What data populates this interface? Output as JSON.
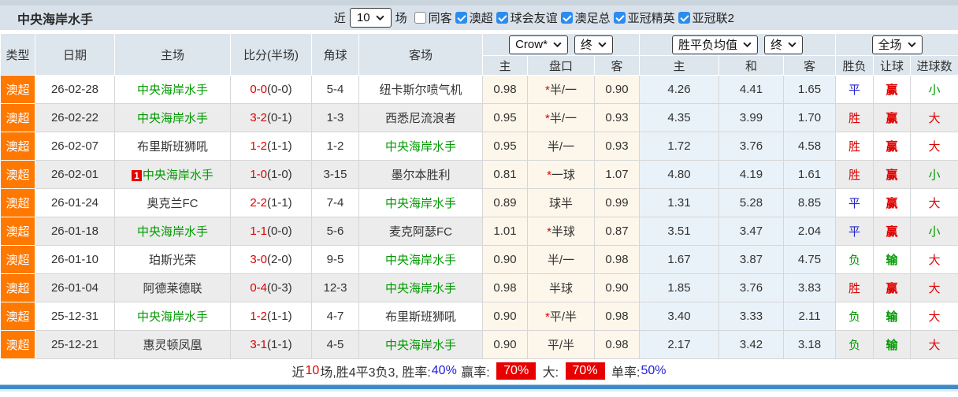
{
  "palette": {
    "orange": "#ff7800",
    "red": "#e00000",
    "green": "#009900",
    "blue": "#2222cc",
    "checkbox_blue": "#2b8ced",
    "header_bg": "#dde6ed",
    "cream_bg": "#fdf6ea",
    "light_blue_bg": "#eaf2f9",
    "bottom_bar_blue": "#3f8ac6"
  },
  "header": {
    "team_title": "中央海岸水手",
    "recent_prefix": "近",
    "recent_value": "10",
    "recent_suffix": "场",
    "filters": [
      {
        "label": "同客",
        "checked": false
      },
      {
        "label": "澳超",
        "checked": true
      },
      {
        "label": "球会友谊",
        "checked": true
      },
      {
        "label": "澳足总",
        "checked": true
      },
      {
        "label": "亚冠精英",
        "checked": true
      },
      {
        "label": "亚冠联2",
        "checked": true
      }
    ]
  },
  "table": {
    "columns": [
      "类型",
      "日期",
      "主场",
      "比分(半场)",
      "角球",
      "客场"
    ],
    "odds_group": {
      "company_select": "Crow*",
      "time_select": "终",
      "subs": [
        "主",
        "盘口",
        "客"
      ]
    },
    "avg_group": {
      "value_select": "胜平负均值",
      "time_select": "终",
      "subs": [
        "主",
        "和",
        "客"
      ]
    },
    "result_group": {
      "scope_select": "全场",
      "subs": [
        "胜负",
        "让球",
        "进球数"
      ]
    },
    "rows": [
      {
        "league": "澳超",
        "date": "26-02-28",
        "home": "中央海岸水手",
        "home_green": true,
        "home_badge": "",
        "score": "0-0",
        "half": "(0-0)",
        "corners": "5-4",
        "away": "纽卡斯尔喷气机",
        "away_green": false,
        "odds_home": "0.98",
        "line": "半/一",
        "line_star": true,
        "odds_away": "0.90",
        "avg_home": "4.26",
        "avg_draw": "4.41",
        "avg_away": "1.65",
        "spf": "平",
        "spf_color": "blue",
        "rq": "赢",
        "rq_color": "red",
        "jq": "小",
        "jq_color": "green"
      },
      {
        "league": "澳超",
        "date": "26-02-22",
        "home": "中央海岸水手",
        "home_green": true,
        "home_badge": "",
        "score": "3-2",
        "half": "(0-1)",
        "corners": "1-3",
        "away": "西悉尼流浪者",
        "away_green": false,
        "odds_home": "0.95",
        "line": "半/一",
        "line_star": true,
        "odds_away": "0.93",
        "avg_home": "4.35",
        "avg_draw": "3.99",
        "avg_away": "1.70",
        "spf": "胜",
        "spf_color": "red",
        "rq": "赢",
        "rq_color": "red",
        "jq": "大",
        "jq_color": "red"
      },
      {
        "league": "澳超",
        "date": "26-02-07",
        "home": "布里斯班狮吼",
        "home_green": false,
        "home_badge": "",
        "score": "1-2",
        "half": "(1-1)",
        "corners": "1-2",
        "away": "中央海岸水手",
        "away_green": true,
        "odds_home": "0.95",
        "line": "半/一",
        "line_star": false,
        "odds_away": "0.93",
        "avg_home": "1.72",
        "avg_draw": "3.76",
        "avg_away": "4.58",
        "spf": "胜",
        "spf_color": "red",
        "rq": "赢",
        "rq_color": "red",
        "jq": "大",
        "jq_color": "red"
      },
      {
        "league": "澳超",
        "date": "26-02-01",
        "home": "中央海岸水手",
        "home_green": true,
        "home_badge": "1",
        "score": "1-0",
        "half": "(1-0)",
        "corners": "3-15",
        "away": "墨尔本胜利",
        "away_green": false,
        "odds_home": "0.81",
        "line": "一球",
        "line_star": true,
        "odds_away": "1.07",
        "avg_home": "4.80",
        "avg_draw": "4.19",
        "avg_away": "1.61",
        "spf": "胜",
        "spf_color": "red",
        "rq": "赢",
        "rq_color": "red",
        "jq": "小",
        "jq_color": "green"
      },
      {
        "league": "澳超",
        "date": "26-01-24",
        "home": "奥克兰FC",
        "home_green": false,
        "home_badge": "",
        "score": "2-2",
        "half": "(1-1)",
        "corners": "7-4",
        "away": "中央海岸水手",
        "away_green": true,
        "odds_home": "0.89",
        "line": "球半",
        "line_star": false,
        "odds_away": "0.99",
        "avg_home": "1.31",
        "avg_draw": "5.28",
        "avg_away": "8.85",
        "spf": "平",
        "spf_color": "blue",
        "rq": "赢",
        "rq_color": "red",
        "jq": "大",
        "jq_color": "red"
      },
      {
        "league": "澳超",
        "date": "26-01-18",
        "home": "中央海岸水手",
        "home_green": true,
        "home_badge": "",
        "score": "1-1",
        "half": "(0-0)",
        "corners": "5-6",
        "away": "麦克阿瑟FC",
        "away_green": false,
        "odds_home": "1.01",
        "line": "半球",
        "line_star": true,
        "odds_away": "0.87",
        "avg_home": "3.51",
        "avg_draw": "3.47",
        "avg_away": "2.04",
        "spf": "平",
        "spf_color": "blue",
        "rq": "赢",
        "rq_color": "red",
        "jq": "小",
        "jq_color": "green"
      },
      {
        "league": "澳超",
        "date": "26-01-10",
        "home": "珀斯光荣",
        "home_green": false,
        "home_badge": "",
        "score": "3-0",
        "half": "(2-0)",
        "corners": "9-5",
        "away": "中央海岸水手",
        "away_green": true,
        "odds_home": "0.90",
        "line": "半/一",
        "line_star": false,
        "odds_away": "0.98",
        "avg_home": "1.67",
        "avg_draw": "3.87",
        "avg_away": "4.75",
        "spf": "负",
        "spf_color": "green",
        "rq": "输",
        "rq_color": "green",
        "jq": "大",
        "jq_color": "red"
      },
      {
        "league": "澳超",
        "date": "26-01-04",
        "home": "阿德莱德联",
        "home_green": false,
        "home_badge": "",
        "score": "0-4",
        "half": "(0-3)",
        "corners": "12-3",
        "away": "中央海岸水手",
        "away_green": true,
        "odds_home": "0.98",
        "line": "半球",
        "line_star": false,
        "odds_away": "0.90",
        "avg_home": "1.85",
        "avg_draw": "3.76",
        "avg_away": "3.83",
        "spf": "胜",
        "spf_color": "red",
        "rq": "赢",
        "rq_color": "red",
        "jq": "大",
        "jq_color": "red"
      },
      {
        "league": "澳超",
        "date": "25-12-31",
        "home": "中央海岸水手",
        "home_green": true,
        "home_badge": "",
        "score": "1-2",
        "half": "(1-1)",
        "corners": "4-7",
        "away": "布里斯班狮吼",
        "away_green": false,
        "odds_home": "0.90",
        "line": "平/半",
        "line_star": true,
        "odds_away": "0.98",
        "avg_home": "3.40",
        "avg_draw": "3.33",
        "avg_away": "2.11",
        "spf": "负",
        "spf_color": "green",
        "rq": "输",
        "rq_color": "green",
        "jq": "大",
        "jq_color": "red"
      },
      {
        "league": "澳超",
        "date": "25-12-21",
        "home": "惠灵顿凤凰",
        "home_green": false,
        "home_badge": "",
        "score": "3-1",
        "half": "(1-1)",
        "corners": "4-5",
        "away": "中央海岸水手",
        "away_green": true,
        "odds_home": "0.90",
        "line": "平/半",
        "line_star": false,
        "odds_away": "0.98",
        "avg_home": "2.17",
        "avg_draw": "3.42",
        "avg_away": "3.18",
        "spf": "负",
        "spf_color": "green",
        "rq": "输",
        "rq_color": "green",
        "jq": "大",
        "jq_color": "red"
      }
    ]
  },
  "summary": {
    "parts": [
      {
        "t": "近",
        "c": "dark"
      },
      {
        "t": "10",
        "c": "red"
      },
      {
        "t": "场,胜4平3负3, 胜率:",
        "c": "dark"
      },
      {
        "t": "40%",
        "c": "blue"
      },
      {
        "t": " 赢率: ",
        "c": "dark"
      },
      {
        "t": "70%",
        "c": "badge"
      },
      {
        "t": " 大: ",
        "c": "dark"
      },
      {
        "t": "70%",
        "c": "badge"
      },
      {
        "t": " 单率:",
        "c": "dark"
      },
      {
        "t": "50%",
        "c": "blue"
      }
    ]
  }
}
